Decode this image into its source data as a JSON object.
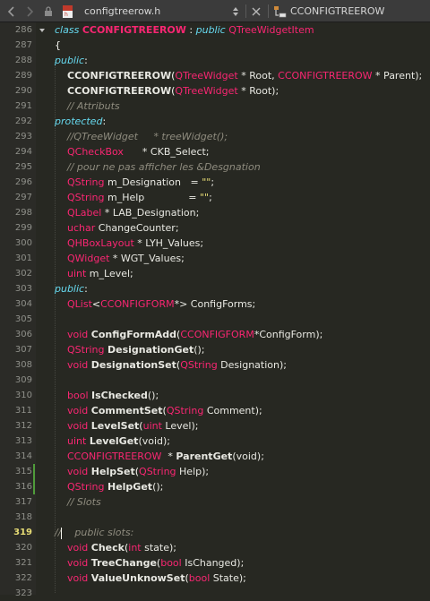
{
  "toolbar": {
    "back_icon": "chevron-left-icon",
    "forward_icon": "chevron-right-icon",
    "lock_icon": "lock-icon",
    "file_icon": "cpp-header-file-icon",
    "file_name": "configtreerow.h",
    "dropdown_icon": "up-down-arrows-icon",
    "close_icon": "close-icon",
    "symbol_icon": "class-symbol-icon",
    "current_symbol": "CCONFIGTREEROW"
  },
  "editor": {
    "current_line": 319,
    "lines": [
      {
        "n": "286",
        "fold": true,
        "change": false,
        "tokens": [
          {
            "t": "class ",
            "c": "kw"
          },
          {
            "t": "CCONFIGTREEROW",
            "c": "cls"
          },
          {
            "t": " : ",
            "c": "pu"
          },
          {
            "t": "public ",
            "c": "kw"
          },
          {
            "t": "QTreeWidgetItem",
            "c": "ty"
          }
        ]
      },
      {
        "n": "287",
        "tokens": [
          {
            "t": "{",
            "c": "pu"
          }
        ]
      },
      {
        "n": "288",
        "tokens": [
          {
            "t": "public",
            "c": "kw"
          },
          {
            "t": ":",
            "c": "pu"
          }
        ]
      },
      {
        "n": "289",
        "tokens": [
          {
            "t": "    ",
            "c": "tx"
          },
          {
            "t": "CCONFIGTREEROW",
            "c": "fn"
          },
          {
            "t": "(",
            "c": "pu"
          },
          {
            "t": "QTreeWidget",
            "c": "ty"
          },
          {
            "t": " * Root, ",
            "c": "tx"
          },
          {
            "t": "CCONFIGTREEROW",
            "c": "ty"
          },
          {
            "t": " * Parent);",
            "c": "tx"
          }
        ]
      },
      {
        "n": "290",
        "tokens": [
          {
            "t": "    ",
            "c": "tx"
          },
          {
            "t": "CCONFIGTREEROW",
            "c": "fn"
          },
          {
            "t": "(",
            "c": "pu"
          },
          {
            "t": "QTreeWidget",
            "c": "ty"
          },
          {
            "t": " * Root);",
            "c": "tx"
          }
        ]
      },
      {
        "n": "291",
        "tokens": [
          {
            "t": "    // Attributs",
            "c": "cm"
          }
        ]
      },
      {
        "n": "292",
        "tokens": [
          {
            "t": "protected",
            "c": "kw"
          },
          {
            "t": ":",
            "c": "pu"
          }
        ]
      },
      {
        "n": "293",
        "tokens": [
          {
            "t": "    //QTreeWidget     * treeWidget();",
            "c": "cm"
          }
        ]
      },
      {
        "n": "294",
        "tokens": [
          {
            "t": "    ",
            "c": "tx"
          },
          {
            "t": "QCheckBox",
            "c": "ty"
          },
          {
            "t": "      * CKB_Select;",
            "c": "tx"
          }
        ]
      },
      {
        "n": "295",
        "tokens": [
          {
            "t": "    // pour ne pas afficher les &Desgnation",
            "c": "cm"
          }
        ]
      },
      {
        "n": "296",
        "tokens": [
          {
            "t": "    ",
            "c": "tx"
          },
          {
            "t": "QString",
            "c": "ty"
          },
          {
            "t": " m_Designation   = ",
            "c": "tx"
          },
          {
            "t": "\"\"",
            "c": "st"
          },
          {
            "t": ";",
            "c": "tx"
          }
        ]
      },
      {
        "n": "297",
        "tokens": [
          {
            "t": "    ",
            "c": "tx"
          },
          {
            "t": "QString",
            "c": "ty"
          },
          {
            "t": " m_Help              = ",
            "c": "tx"
          },
          {
            "t": "\"\"",
            "c": "st"
          },
          {
            "t": ";",
            "c": "tx"
          }
        ]
      },
      {
        "n": "298",
        "tokens": [
          {
            "t": "    ",
            "c": "tx"
          },
          {
            "t": "QLabel",
            "c": "ty"
          },
          {
            "t": " * LAB_Designation;",
            "c": "tx"
          }
        ]
      },
      {
        "n": "299",
        "tokens": [
          {
            "t": "    ",
            "c": "tx"
          },
          {
            "t": "uchar",
            "c": "ty"
          },
          {
            "t": " ChangeCounter;",
            "c": "tx"
          }
        ]
      },
      {
        "n": "300",
        "tokens": [
          {
            "t": "    ",
            "c": "tx"
          },
          {
            "t": "QHBoxLayout",
            "c": "ty"
          },
          {
            "t": " * LYH_Values;",
            "c": "tx"
          }
        ]
      },
      {
        "n": "301",
        "tokens": [
          {
            "t": "    ",
            "c": "tx"
          },
          {
            "t": "QWidget",
            "c": "ty"
          },
          {
            "t": " * WGT_Values;",
            "c": "tx"
          }
        ]
      },
      {
        "n": "302",
        "tokens": [
          {
            "t": "    ",
            "c": "tx"
          },
          {
            "t": "uint",
            "c": "ty"
          },
          {
            "t": " m_Level;",
            "c": "tx"
          }
        ]
      },
      {
        "n": "303",
        "tokens": [
          {
            "t": "public",
            "c": "kw"
          },
          {
            "t": ":",
            "c": "pu"
          }
        ]
      },
      {
        "n": "304",
        "tokens": [
          {
            "t": "    ",
            "c": "tx"
          },
          {
            "t": "QList",
            "c": "ty"
          },
          {
            "t": "<",
            "c": "pu"
          },
          {
            "t": "CCONFIGFORM",
            "c": "ty"
          },
          {
            "t": "*> ConfigForms;",
            "c": "tx"
          }
        ]
      },
      {
        "n": "305",
        "tokens": []
      },
      {
        "n": "306",
        "tokens": [
          {
            "t": "    ",
            "c": "tx"
          },
          {
            "t": "void",
            "c": "ty"
          },
          {
            "t": " ",
            "c": "tx"
          },
          {
            "t": "ConfigFormAdd",
            "c": "fn"
          },
          {
            "t": "(",
            "c": "pu"
          },
          {
            "t": "CCONFIGFORM",
            "c": "ty"
          },
          {
            "t": "*ConfigForm);",
            "c": "tx"
          }
        ]
      },
      {
        "n": "307",
        "tokens": [
          {
            "t": "    ",
            "c": "tx"
          },
          {
            "t": "QString",
            "c": "ty"
          },
          {
            "t": " ",
            "c": "tx"
          },
          {
            "t": "DesignationGet",
            "c": "fn"
          },
          {
            "t": "();",
            "c": "tx"
          }
        ]
      },
      {
        "n": "308",
        "tokens": [
          {
            "t": "    ",
            "c": "tx"
          },
          {
            "t": "void",
            "c": "ty"
          },
          {
            "t": " ",
            "c": "tx"
          },
          {
            "t": "DesignationSet",
            "c": "fn"
          },
          {
            "t": "(",
            "c": "pu"
          },
          {
            "t": "QString",
            "c": "ty"
          },
          {
            "t": " Designation);",
            "c": "tx"
          }
        ]
      },
      {
        "n": "309",
        "tokens": []
      },
      {
        "n": "310",
        "tokens": [
          {
            "t": "    ",
            "c": "tx"
          },
          {
            "t": "bool",
            "c": "ty"
          },
          {
            "t": " ",
            "c": "tx"
          },
          {
            "t": "IsChecked",
            "c": "fn"
          },
          {
            "t": "();",
            "c": "tx"
          }
        ]
      },
      {
        "n": "311",
        "tokens": [
          {
            "t": "    ",
            "c": "tx"
          },
          {
            "t": "void",
            "c": "ty"
          },
          {
            "t": " ",
            "c": "tx"
          },
          {
            "t": "CommentSet",
            "c": "fn"
          },
          {
            "t": "(",
            "c": "pu"
          },
          {
            "t": "QString",
            "c": "ty"
          },
          {
            "t": " Comment);",
            "c": "tx"
          }
        ]
      },
      {
        "n": "312",
        "tokens": [
          {
            "t": "    ",
            "c": "tx"
          },
          {
            "t": "void",
            "c": "ty"
          },
          {
            "t": " ",
            "c": "tx"
          },
          {
            "t": "LevelSet",
            "c": "fn"
          },
          {
            "t": "(",
            "c": "pu"
          },
          {
            "t": "uint",
            "c": "ty"
          },
          {
            "t": " Level);",
            "c": "tx"
          }
        ]
      },
      {
        "n": "313",
        "tokens": [
          {
            "t": "    ",
            "c": "tx"
          },
          {
            "t": "uint",
            "c": "ty"
          },
          {
            "t": " ",
            "c": "tx"
          },
          {
            "t": "LevelGet",
            "c": "fn"
          },
          {
            "t": "(void);",
            "c": "tx"
          }
        ]
      },
      {
        "n": "314",
        "tokens": [
          {
            "t": "    ",
            "c": "tx"
          },
          {
            "t": "CCONFIGTREEROW",
            "c": "ty"
          },
          {
            "t": "  * ",
            "c": "tx"
          },
          {
            "t": "ParentGet",
            "c": "fn"
          },
          {
            "t": "(void);",
            "c": "tx"
          }
        ]
      },
      {
        "n": "315",
        "change": true,
        "tokens": [
          {
            "t": "    ",
            "c": "tx"
          },
          {
            "t": "void",
            "c": "ty"
          },
          {
            "t": " ",
            "c": "tx"
          },
          {
            "t": "HelpSet",
            "c": "fn"
          },
          {
            "t": "(",
            "c": "pu"
          },
          {
            "t": "QString",
            "c": "ty"
          },
          {
            "t": " Help);",
            "c": "tx"
          }
        ]
      },
      {
        "n": "316",
        "change": true,
        "tokens": [
          {
            "t": "    ",
            "c": "tx"
          },
          {
            "t": "QString",
            "c": "ty"
          },
          {
            "t": " ",
            "c": "tx"
          },
          {
            "t": "HelpGet",
            "c": "fn"
          },
          {
            "t": "();",
            "c": "tx"
          }
        ]
      },
      {
        "n": "317",
        "tokens": [
          {
            "t": "    // Slots",
            "c": "cm"
          }
        ]
      },
      {
        "n": "318",
        "tokens": []
      },
      {
        "n": "319",
        "cursor": true,
        "tokens": [
          {
            "t": "//",
            "c": "cm"
          },
          {
            "t": "CURSOR",
            "c": "cursor"
          },
          {
            "t": "    public slots:",
            "c": "cm"
          }
        ]
      },
      {
        "n": "320",
        "tokens": [
          {
            "t": "    ",
            "c": "tx"
          },
          {
            "t": "void",
            "c": "ty"
          },
          {
            "t": " ",
            "c": "tx"
          },
          {
            "t": "Check",
            "c": "fn"
          },
          {
            "t": "(",
            "c": "pu"
          },
          {
            "t": "int",
            "c": "ty"
          },
          {
            "t": " state);",
            "c": "tx"
          }
        ]
      },
      {
        "n": "321",
        "tokens": [
          {
            "t": "    ",
            "c": "tx"
          },
          {
            "t": "void",
            "c": "ty"
          },
          {
            "t": " ",
            "c": "tx"
          },
          {
            "t": "TreeChange",
            "c": "fn"
          },
          {
            "t": "(",
            "c": "pu"
          },
          {
            "t": "bool",
            "c": "ty"
          },
          {
            "t": " IsChanged);",
            "c": "tx"
          }
        ]
      },
      {
        "n": "322",
        "tokens": [
          {
            "t": "    ",
            "c": "tx"
          },
          {
            "t": "void",
            "c": "ty"
          },
          {
            "t": " ",
            "c": "tx"
          },
          {
            "t": "ValueUnknowSet",
            "c": "fn"
          },
          {
            "t": "(",
            "c": "pu"
          },
          {
            "t": "bool",
            "c": "ty"
          },
          {
            "t": " State);",
            "c": "tx"
          }
        ]
      },
      {
        "n": "323",
        "tokens": []
      }
    ]
  }
}
